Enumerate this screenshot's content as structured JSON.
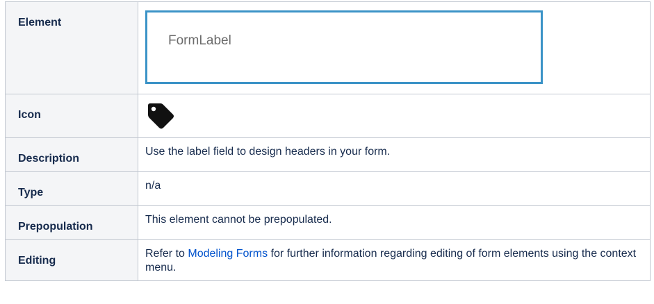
{
  "rows": {
    "element": {
      "label": "Element",
      "preview_text": "FormLabel"
    },
    "icon": {
      "label": "Icon",
      "icon_name": "tag-icon"
    },
    "description": {
      "label": "Description",
      "value": "Use the label field to design headers in your form."
    },
    "type": {
      "label": "Type",
      "value": "n/a"
    },
    "prepopulation": {
      "label": "Prepopulation",
      "value": "This element cannot be prepopulated."
    },
    "editing": {
      "label": "Editing",
      "prefix": "Refer to ",
      "link_text": "Modeling Forms",
      "suffix": " for further information regarding editing of form elements using the context menu."
    }
  },
  "colors": {
    "header_bg": "#f4f5f7",
    "border": "#c1c7d0",
    "preview_border": "#3b93c7",
    "link": "#0052cc"
  }
}
